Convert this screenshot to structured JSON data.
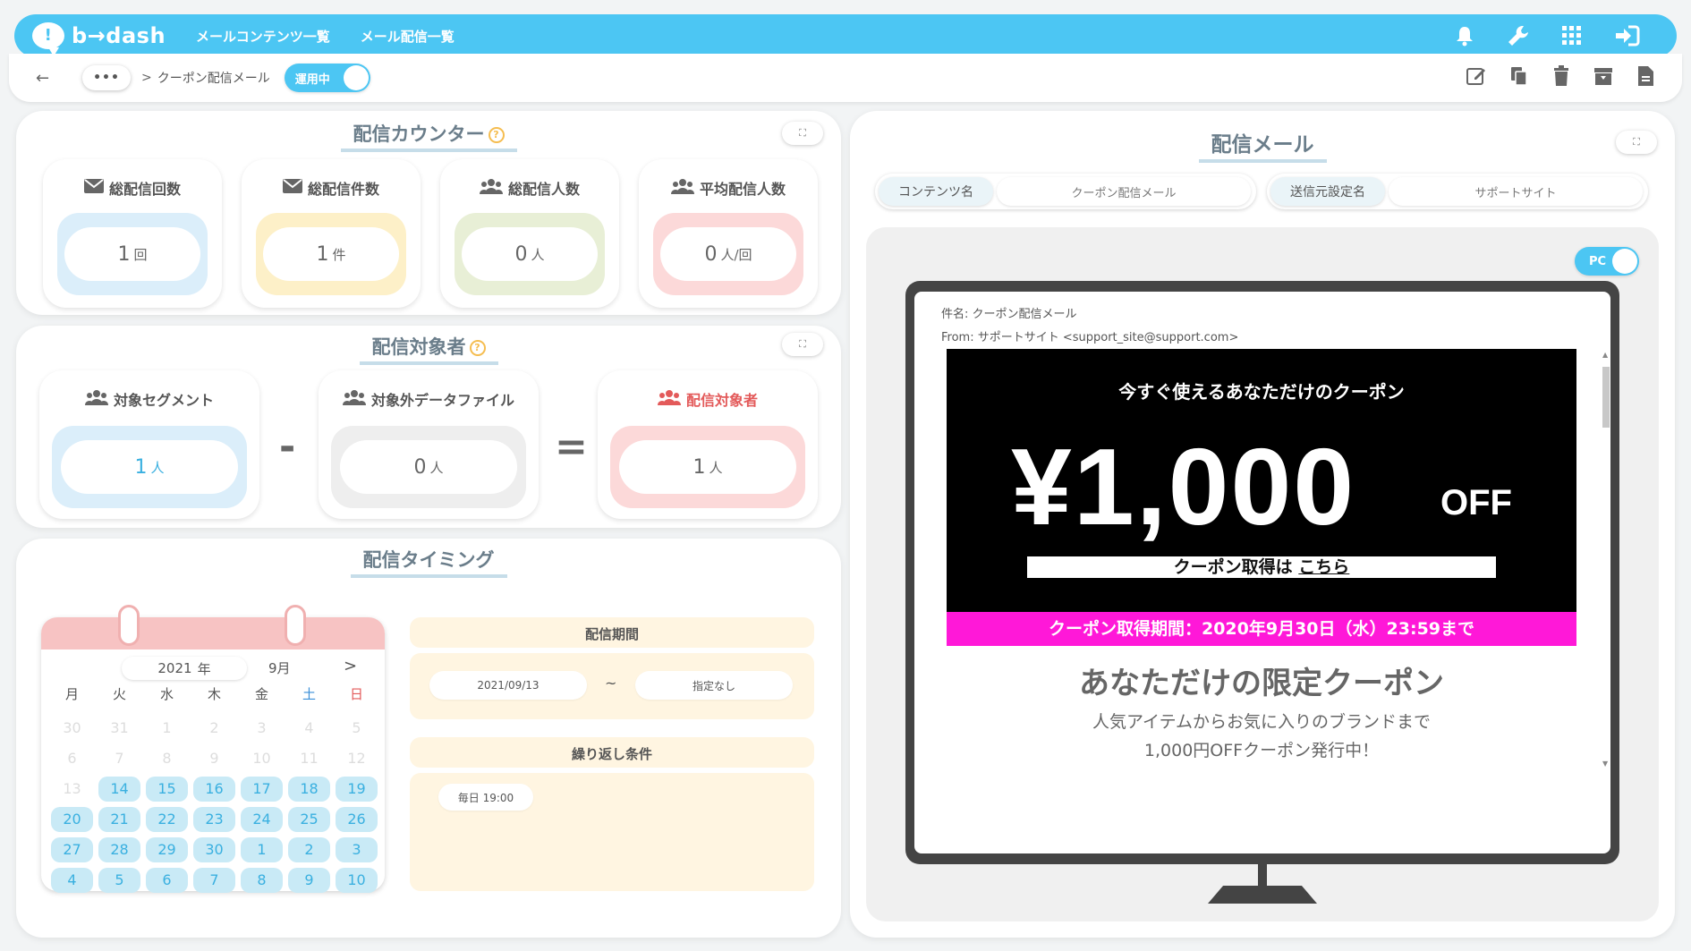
{
  "header": {
    "logo": "b→dash",
    "nav": [
      "メールコンテンツ一覧",
      "メール配信一覧"
    ],
    "icons": [
      "bell-icon",
      "wrench-icon",
      "grid-icon",
      "logout-icon"
    ]
  },
  "subbar": {
    "breadcrumb_dots": "•••",
    "separator": ">",
    "current": "クーポン配信メール",
    "status_label": "運用中",
    "actions": [
      "edit-icon",
      "copy-icon",
      "trash-icon",
      "archive-icon",
      "document-icon"
    ]
  },
  "counter": {
    "title": "配信カウンター",
    "help": "?",
    "expand": "⛶",
    "cards": [
      {
        "title": "総配信回数",
        "value": "1",
        "unit": "回",
        "color": "#dbeefa"
      },
      {
        "title": "総配信件数",
        "value": "1",
        "unit": "件",
        "color": "#fdf0c8"
      },
      {
        "title": "総配信人数",
        "value": "0",
        "unit": "人",
        "color": "#e8efd6"
      },
      {
        "title": "平均配信人数",
        "value": "0",
        "unit": "人/回",
        "color": "#fcd9d9"
      }
    ]
  },
  "target": {
    "title": "配信対象者",
    "help": "?",
    "expand": "⛶",
    "minus": "-",
    "equals": "=",
    "cards": [
      {
        "title": "対象セグメント",
        "value": "1",
        "unit": "人",
        "color": "#dbeefa"
      },
      {
        "title": "対象外データファイル",
        "value": "0",
        "unit": "人",
        "color": "#eeeeee"
      },
      {
        "title": "配信対象者",
        "value": "1",
        "unit": "人",
        "color": "#fcd9d9"
      }
    ]
  },
  "timing": {
    "title": "配信タイミング",
    "calendar": {
      "year": "2021",
      "year_unit": "年",
      "month": "9月",
      "next": ">",
      "weekdays": [
        "月",
        "火",
        "水",
        "木",
        "金",
        "土",
        "日"
      ],
      "weeks": [
        [
          {
            "d": "30",
            "a": false
          },
          {
            "d": "31",
            "a": false
          },
          {
            "d": "1",
            "a": false
          },
          {
            "d": "2",
            "a": false
          },
          {
            "d": "3",
            "a": false
          },
          {
            "d": "4",
            "a": false
          },
          {
            "d": "5",
            "a": false
          }
        ],
        [
          {
            "d": "6",
            "a": false
          },
          {
            "d": "7",
            "a": false
          },
          {
            "d": "8",
            "a": false
          },
          {
            "d": "9",
            "a": false
          },
          {
            "d": "10",
            "a": false
          },
          {
            "d": "11",
            "a": false
          },
          {
            "d": "12",
            "a": false
          }
        ],
        [
          {
            "d": "13",
            "a": false
          },
          {
            "d": "14",
            "a": true
          },
          {
            "d": "15",
            "a": true
          },
          {
            "d": "16",
            "a": true
          },
          {
            "d": "17",
            "a": true
          },
          {
            "d": "18",
            "a": true
          },
          {
            "d": "19",
            "a": true
          }
        ],
        [
          {
            "d": "20",
            "a": true
          },
          {
            "d": "21",
            "a": true
          },
          {
            "d": "22",
            "a": true
          },
          {
            "d": "23",
            "a": true
          },
          {
            "d": "24",
            "a": true
          },
          {
            "d": "25",
            "a": true
          },
          {
            "d": "26",
            "a": true
          }
        ],
        [
          {
            "d": "27",
            "a": true
          },
          {
            "d": "28",
            "a": true
          },
          {
            "d": "29",
            "a": true
          },
          {
            "d": "30",
            "a": true
          },
          {
            "d": "1",
            "a": true
          },
          {
            "d": "2",
            "a": true
          },
          {
            "d": "3",
            "a": true
          }
        ],
        [
          {
            "d": "4",
            "a": true
          },
          {
            "d": "5",
            "a": true
          },
          {
            "d": "6",
            "a": true
          },
          {
            "d": "7",
            "a": true
          },
          {
            "d": "8",
            "a": true
          },
          {
            "d": "9",
            "a": true
          },
          {
            "d": "10",
            "a": true
          }
        ]
      ]
    },
    "period": {
      "title": "配信期間",
      "start": "2021/09/13",
      "tilde": "~",
      "end": "指定なし"
    },
    "repeat": {
      "title": "繰り返し条件",
      "value": "毎日 19:00"
    }
  },
  "mail": {
    "title": "配信メール",
    "expand": "⛶",
    "content_key": "コンテンツ名",
    "content_val": "クーポン配信メール",
    "sender_key": "送信元設定名",
    "sender_val": "サポートサイト",
    "device_toggle": "PC",
    "subject": "件名: クーポン配信メール",
    "from": "From: サポートサイト <support_site@support.com>",
    "body": {
      "sub": "今すぐ使えるあなただけのクーポン",
      "price": "¥1,000",
      "off": "OFF",
      "btn_prefix": "クーポン取得は ",
      "btn_link": "こちら",
      "period": "クーポン取得期間：2020年9月30日（水）23:59まで",
      "heading": "あなただけの限定クーポン",
      "line1": "人気アイテムからお気に入りのブランドまで",
      "line2": "1,000円OFFクーポン発行中！"
    }
  },
  "colors": {
    "accent": "#4cc6f3",
    "pink": "#ff18d8"
  }
}
